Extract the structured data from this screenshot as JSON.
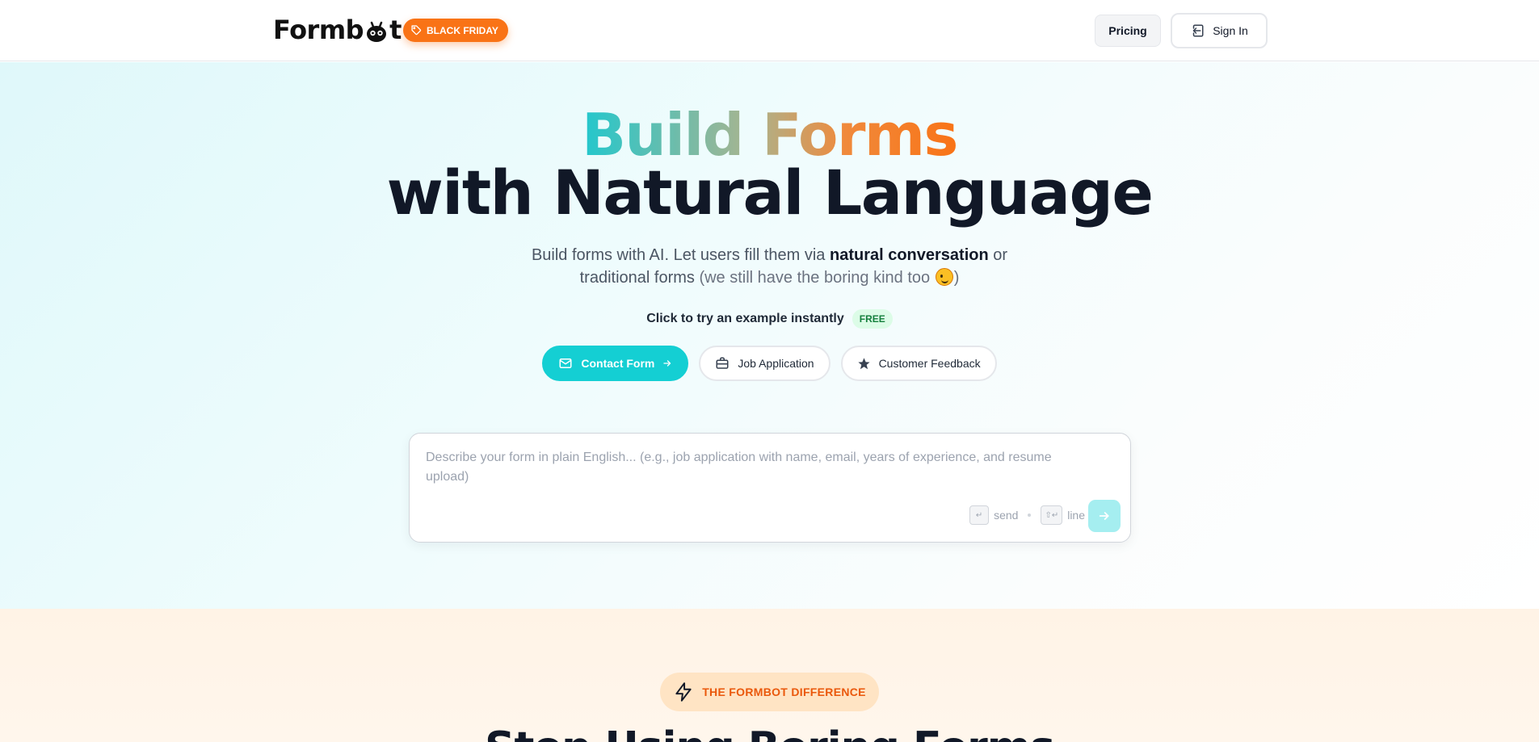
{
  "header": {
    "logo_text_left": "Form",
    "logo_text_right": "t",
    "logo_letter_b": "b",
    "badge": "BLACK FRIDAY",
    "pricing_label": "Pricing",
    "signin_label": "Sign In"
  },
  "hero": {
    "title_gradient": "Build Forms",
    "title_main": "with Natural Language",
    "subtitle_part1": "Build forms with AI. Let users fill them via ",
    "subtitle_bold": "natural conversation",
    "subtitle_part2": " or",
    "subtitle_line2_a": "traditional forms",
    "subtitle_line2_b": " (we still have the boring kind too ",
    "subtitle_line2_c": ")",
    "try_label": "Click to try an example instantly",
    "free_badge": "FREE",
    "examples": [
      {
        "label": "Contact Form",
        "icon": "mail-icon",
        "active": true
      },
      {
        "label": "Job Application",
        "icon": "briefcase-icon",
        "active": false
      },
      {
        "label": "Customer Feedback",
        "icon": "star-icon",
        "active": false
      }
    ],
    "prompt_placeholder": "Describe your form in plain English... (e.g., job application with name, email, years of experience, and resume upload)",
    "hint_send": "send",
    "hint_line": "line",
    "kbd_enter": "↵",
    "kbd_shift_enter": "⇧↵"
  },
  "lower": {
    "badge": "THE FORMBOT DIFFERENCE",
    "heading": "Stop Using Boring Forms"
  },
  "colors": {
    "accent_teal": "#14cfd3",
    "accent_orange": "#f97316",
    "heading_dark": "#111827"
  }
}
